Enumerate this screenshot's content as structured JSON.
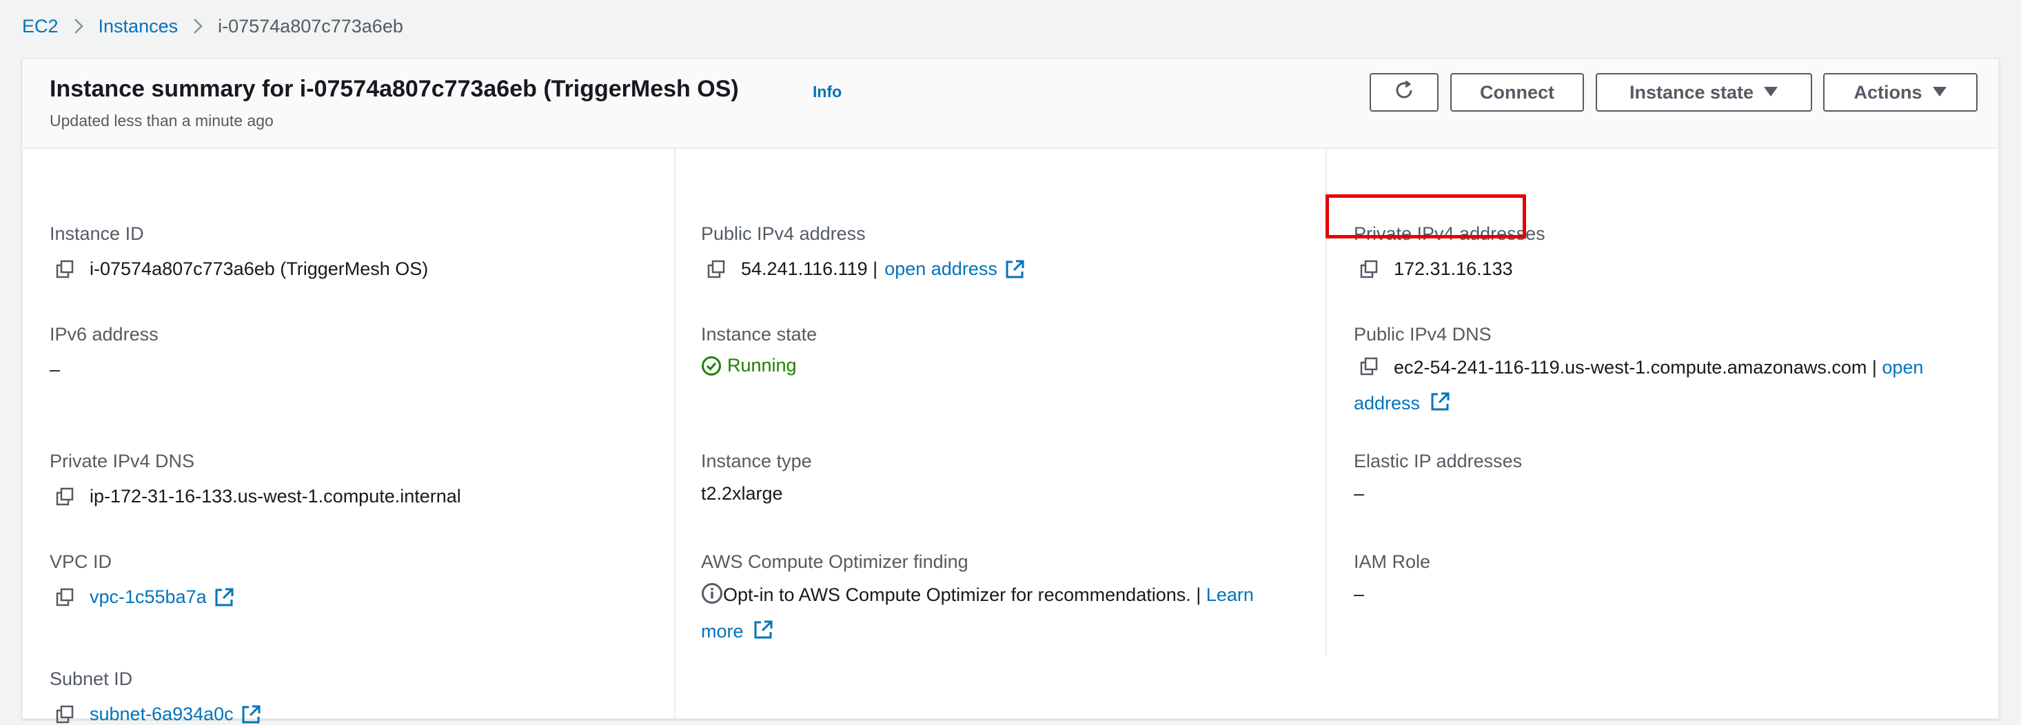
{
  "breadcrumb": {
    "items": [
      "EC2",
      "Instances"
    ],
    "current": "i-07574a807c773a6eb"
  },
  "header": {
    "title": "Instance summary for i-07574a807c773a6eb (TriggerMesh OS)",
    "info": "Info",
    "subtitle": "Updated less than a minute ago",
    "buttons": {
      "connect": "Connect",
      "instance_state": "Instance state",
      "actions": "Actions"
    }
  },
  "details": {
    "instance_id": {
      "label": "Instance ID",
      "value": "i-07574a807c773a6eb (TriggerMesh OS)"
    },
    "public_ipv4": {
      "label": "Public IPv4 address",
      "value": "54.241.116.119 |",
      "link": "open address"
    },
    "private_ipv4": {
      "label": "Private IPv4 addresses",
      "value": "172.31.16.133"
    },
    "ipv6": {
      "label": "IPv6 address",
      "value": "–"
    },
    "instance_state": {
      "label": "Instance state",
      "value": "Running"
    },
    "public_dns": {
      "label": "Public IPv4 DNS",
      "value": "ec2-54-241-116-119.us-west-1.compute.amazonaws.com |",
      "link_part1": "open",
      "link_part2": "address"
    },
    "private_dns": {
      "label": "Private IPv4 DNS",
      "value": "ip-172-31-16-133.us-west-1.compute.internal"
    },
    "instance_type": {
      "label": "Instance type",
      "value": "t2.2xlarge"
    },
    "elastic_ip": {
      "label": "Elastic IP addresses",
      "value": "–"
    },
    "vpc_id": {
      "label": "VPC ID",
      "value": "vpc-1c55ba7a"
    },
    "optimizer": {
      "label": "AWS Compute Optimizer finding",
      "text": "Opt-in to AWS Compute Optimizer for recommendations. |",
      "link_part1": "Learn",
      "link_part2": "more"
    },
    "iam_role": {
      "label": "IAM Role",
      "value": "–"
    },
    "subnet_id": {
      "label": "Subnet ID",
      "value": "subnet-6a934a0c"
    }
  },
  "colors": {
    "link": "#0073bb",
    "running": "#1d8102",
    "highlight": "#e60000"
  }
}
